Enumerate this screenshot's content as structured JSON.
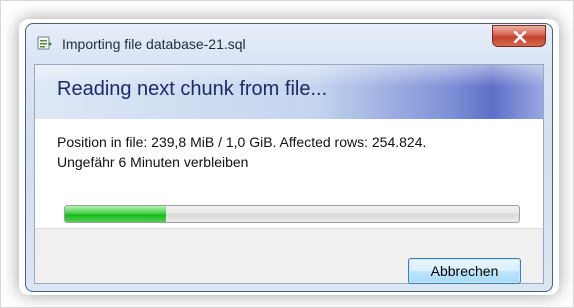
{
  "window": {
    "title": "Importing file database-21.sql",
    "app_icon": "database-import-icon",
    "close_icon": "close-icon"
  },
  "dialog": {
    "heading": "Reading next chunk from file...",
    "status_line_1": "Position in file: 239,8 MiB / 1,0 GiB. Affected rows: 254.824.",
    "status_line_2": "Ungefähr 6 Minuten verbleiben",
    "progress_fraction": 0.223,
    "cancel_label": "Abbrechen"
  },
  "colors": {
    "progress_green": "#16b81b",
    "close_red": "#c2402c",
    "heading_blue": "#1e2a68"
  }
}
